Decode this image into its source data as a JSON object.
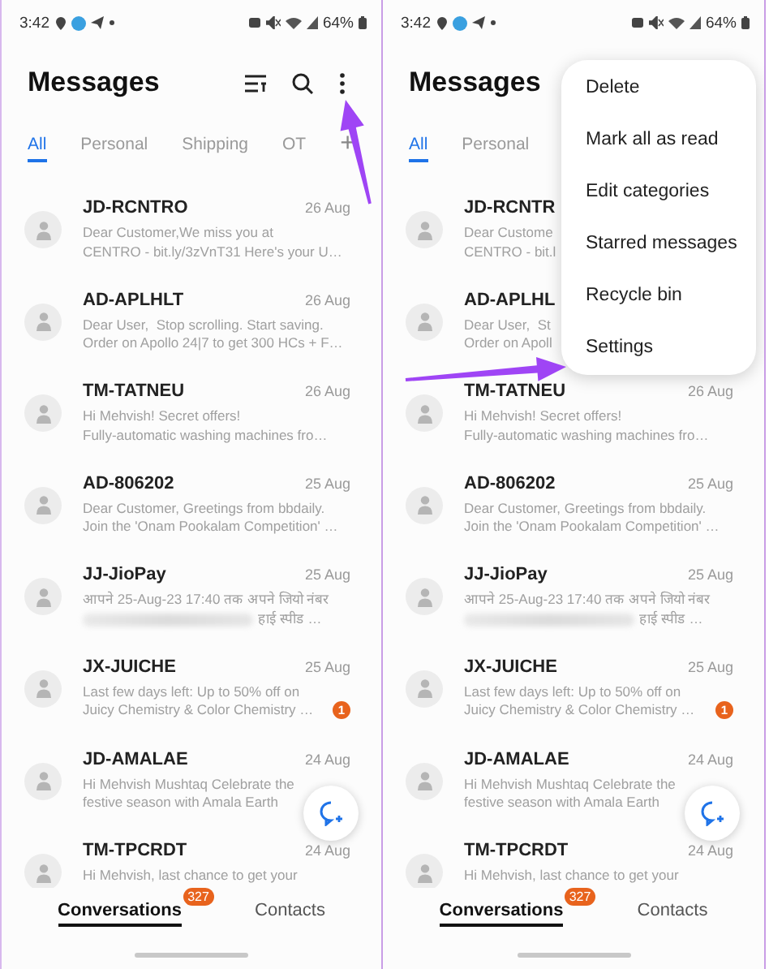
{
  "panels": [
    {
      "status_bar": {
        "time": "3:42",
        "battery": "64%"
      },
      "title": "Messages",
      "tabs": [
        {
          "label": "All",
          "selected": true
        },
        {
          "label": "Personal",
          "selected": false
        },
        {
          "label": "Shipping",
          "selected": false
        },
        {
          "label": "OT",
          "selected": false
        }
      ],
      "add_tab": "+",
      "messages": [
        {
          "sender": "JD-RCNTRO",
          "date": "26 Aug",
          "preview": [
            "Dear Customer,We miss you at",
            "CENTRO - bit.ly/3zVnT31 Here's your U…"
          ]
        },
        {
          "sender": "AD-APLHLT",
          "date": "26 Aug",
          "preview": [
            "Dear User,  Stop scrolling. Start saving.",
            "Order on Apollo 24|7 to get 300 HCs + F…"
          ]
        },
        {
          "sender": "TM-TATNEU",
          "date": "26 Aug",
          "preview": [
            "Hi Mehvish! Secret offers!",
            "Fully-automatic washing machines fro…"
          ]
        },
        {
          "sender": "AD-806202",
          "date": "25 Aug",
          "preview": [
            "Dear Customer, Greetings from bbdaily.",
            "Join the 'Onam Pookalam Competition' …"
          ]
        },
        {
          "sender": "JJ-JioPay",
          "date": "25 Aug",
          "preview": [
            "आपने 25-Aug-23 17:40 तक अपने जियो नंबर",
            "हाई स्पीड …"
          ],
          "redacted": true
        },
        {
          "sender": "JX-JUICHE",
          "date": "25 Aug",
          "preview": [
            "Last few days left: Up to 50% off on",
            "Juicy Chemistry & Color Chemistry …"
          ],
          "unread": "1"
        },
        {
          "sender": "JD-AMALAE",
          "date": "24 Aug",
          "preview": [
            "Hi Mehvish Mushtaq Celebrate the",
            "festive season with Amala Earth"
          ]
        },
        {
          "sender": "TM-TPCRDT",
          "date": "24 Aug",
          "preview": [
            "Hi Mehvish, last chance to get your"
          ]
        }
      ],
      "bottom_nav": [
        {
          "label": "Conversations",
          "selected": true,
          "badge": "327"
        },
        {
          "label": "Contacts",
          "selected": false
        }
      ],
      "pointer_arrow": true
    },
    {
      "status_bar": {
        "time": "3:42",
        "battery": "64%"
      },
      "title": "Messages",
      "tabs": [
        {
          "label": "All",
          "selected": true
        },
        {
          "label": "Personal",
          "selected": false
        }
      ],
      "messages": [
        {
          "sender": "JD-RCNTR",
          "preview": [
            "Dear Custome",
            "CENTRO - bit.l"
          ]
        },
        {
          "sender": "AD-APLHL",
          "preview": [
            "Dear User,  St",
            "Order on Apoll"
          ]
        },
        {
          "sender": "TM-TATNEU",
          "date": "26 Aug",
          "preview": [
            "Hi Mehvish! Secret offers!",
            "Fully-automatic washing machines fro…"
          ]
        },
        {
          "sender": "AD-806202",
          "date": "25 Aug",
          "preview": [
            "Dear Customer, Greetings from bbdaily.",
            "Join the 'Onam Pookalam Competition' …"
          ]
        },
        {
          "sender": "JJ-JioPay",
          "date": "25 Aug",
          "preview": [
            "आपने 25-Aug-23 17:40 तक अपने जियो नंबर",
            "हाई स्पीड …"
          ],
          "redacted": true
        },
        {
          "sender": "JX-JUICHE",
          "date": "25 Aug",
          "preview": [
            "Last few days left: Up to 50% off on",
            "Juicy Chemistry & Color Chemistry …"
          ],
          "unread": "1"
        },
        {
          "sender": "JD-AMALAE",
          "date": "24 Aug",
          "preview": [
            "Hi Mehvish Mushtaq Celebrate the",
            "festive season with Amala Earth"
          ]
        },
        {
          "sender": "TM-TPCRDT",
          "date": "24 Aug",
          "preview": [
            "Hi Mehvish, last chance to get your"
          ]
        }
      ],
      "bottom_nav": [
        {
          "label": "Conversations",
          "selected": true,
          "badge": "327"
        },
        {
          "label": "Contacts",
          "selected": false
        }
      ],
      "menu": [
        {
          "label": "Delete"
        },
        {
          "label": "Mark all as read"
        },
        {
          "label": "Edit categories"
        },
        {
          "label": "Starred messages"
        },
        {
          "label": "Recycle bin"
        },
        {
          "label": "Settings"
        }
      ],
      "pointer_arrow": true
    }
  ]
}
